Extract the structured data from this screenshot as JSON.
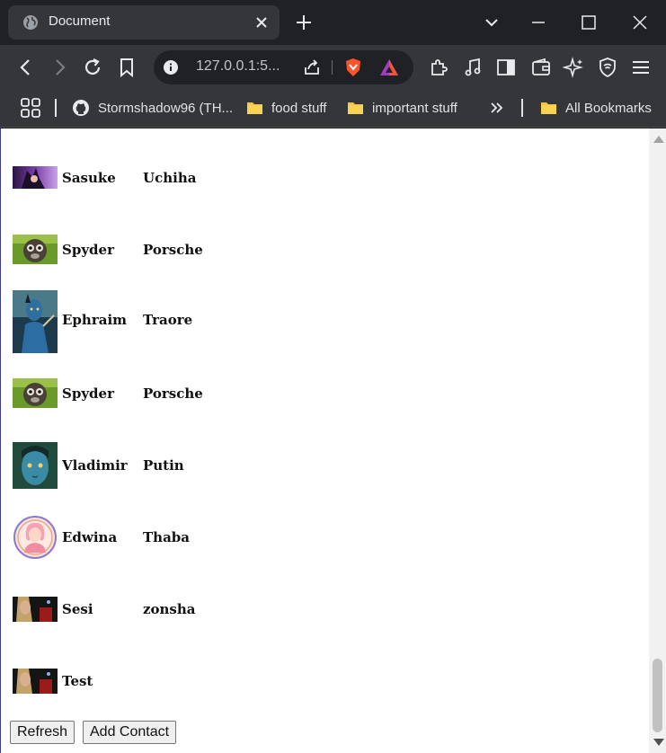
{
  "browser": {
    "tab_title": "Document",
    "url": "127.0.0.1:5...",
    "bookmarks": {
      "github": "Stormshadow96 (TH...",
      "food": "food stuff",
      "important": "important stuff",
      "all": "All Bookmarks"
    },
    "accent": "#202124"
  },
  "contacts": [
    {
      "first": "Sasuke",
      "last": "Uchiha",
      "avatar": "anime-avatar"
    },
    {
      "first": "Spyder",
      "last": "Porsche",
      "avatar": "monkey-avatar"
    },
    {
      "first": "Ephraim",
      "last": "Traore",
      "avatar": "navi-avatar"
    },
    {
      "first": "Spyder",
      "last": "Porsche",
      "avatar": "monkey-avatar"
    },
    {
      "first": "Vladimir",
      "last": "Putin",
      "avatar": "navi-face-avatar"
    },
    {
      "first": "Edwina",
      "last": "Thaba",
      "avatar": "female-icon-avatar"
    },
    {
      "first": "Sesi",
      "last": "zonsha",
      "avatar": "thor-avatar"
    },
    {
      "first": "Test",
      "last": "",
      "avatar": "thor-avatar"
    }
  ],
  "buttons": {
    "refresh": "Refresh",
    "add_contact": "Add Contact"
  }
}
